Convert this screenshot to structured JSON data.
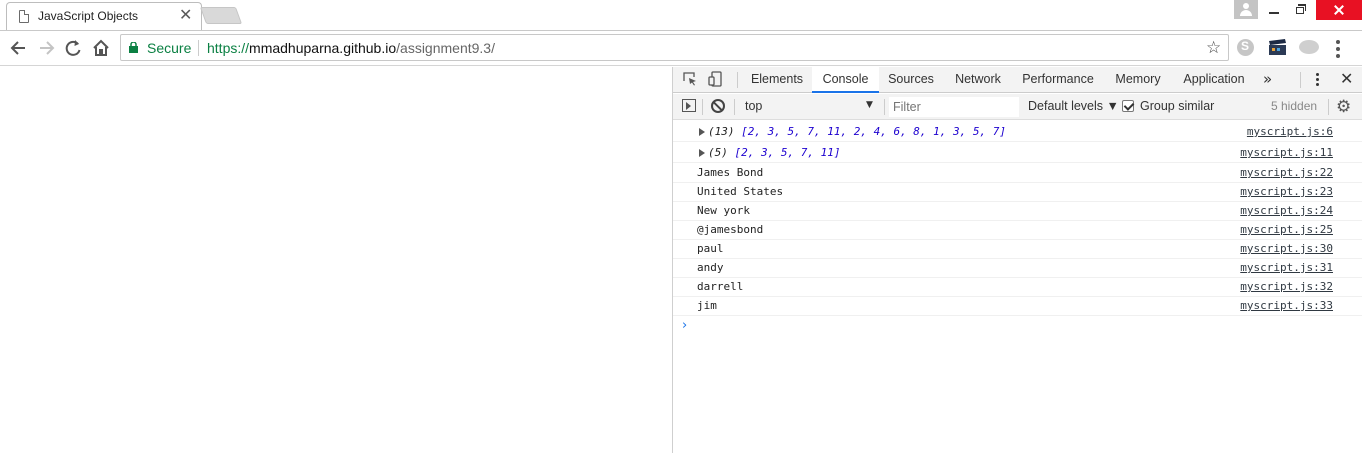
{
  "browser": {
    "tab": {
      "title": "JavaScript Objects",
      "close_glyph": "✕"
    },
    "omnibox": {
      "secure_label": "Secure",
      "url_scheme": "https://",
      "url_host": "mmadhuparna.github.io",
      "url_path": "/assignment9.3/"
    },
    "icons": {
      "back": "back-arrow-icon",
      "forward": "forward-arrow-icon",
      "reload": "reload-icon",
      "home": "home-icon",
      "star": "☆",
      "more_tabs": "»"
    }
  },
  "devtools": {
    "tabs": [
      {
        "label": "Elements",
        "active": false
      },
      {
        "label": "Console",
        "active": true
      },
      {
        "label": "Sources",
        "active": false
      },
      {
        "label": "Network",
        "active": false
      },
      {
        "label": "Performance",
        "active": false
      },
      {
        "label": "Memory",
        "active": false
      },
      {
        "label": "Application",
        "active": false
      }
    ],
    "more_glyph": "»",
    "close_glyph": "✕",
    "console_toolbar": {
      "context": "top",
      "filter_placeholder": "Filter",
      "levels": "Default levels ▼",
      "group_similar_label": "Group similar",
      "group_similar_checked": true,
      "hidden_count": "5 hidden",
      "settings_glyph": "⚙"
    },
    "messages": [
      {
        "type": "array",
        "count": "(13)",
        "values": "[2, 3, 5, 7, 11, 2, 4, 6, 8, 1, 3, 5, 7]",
        "source": "myscript.js:6"
      },
      {
        "type": "array",
        "count": "(5)",
        "values": "[2, 3, 5, 7, 11]",
        "source": "myscript.js:11"
      },
      {
        "type": "text",
        "text": "James Bond",
        "source": "myscript.js:22"
      },
      {
        "type": "text",
        "text": "United States",
        "source": "myscript.js:23"
      },
      {
        "type": "text",
        "text": "New york",
        "source": "myscript.js:24"
      },
      {
        "type": "text",
        "text": "@jamesbond",
        "source": "myscript.js:25"
      },
      {
        "type": "text",
        "text": "paul",
        "source": "myscript.js:30"
      },
      {
        "type": "text",
        "text": "andy",
        "source": "myscript.js:31"
      },
      {
        "type": "text",
        "text": "darrell",
        "source": "myscript.js:32"
      },
      {
        "type": "text",
        "text": "jim",
        "source": "myscript.js:33"
      }
    ],
    "prompt_glyph": "›"
  },
  "colors": {
    "secure_green": "#0b8043",
    "active_tab_underline": "#1a73e8",
    "array_number_blue": "#1c00cf",
    "close_button_red": "#e81123"
  }
}
